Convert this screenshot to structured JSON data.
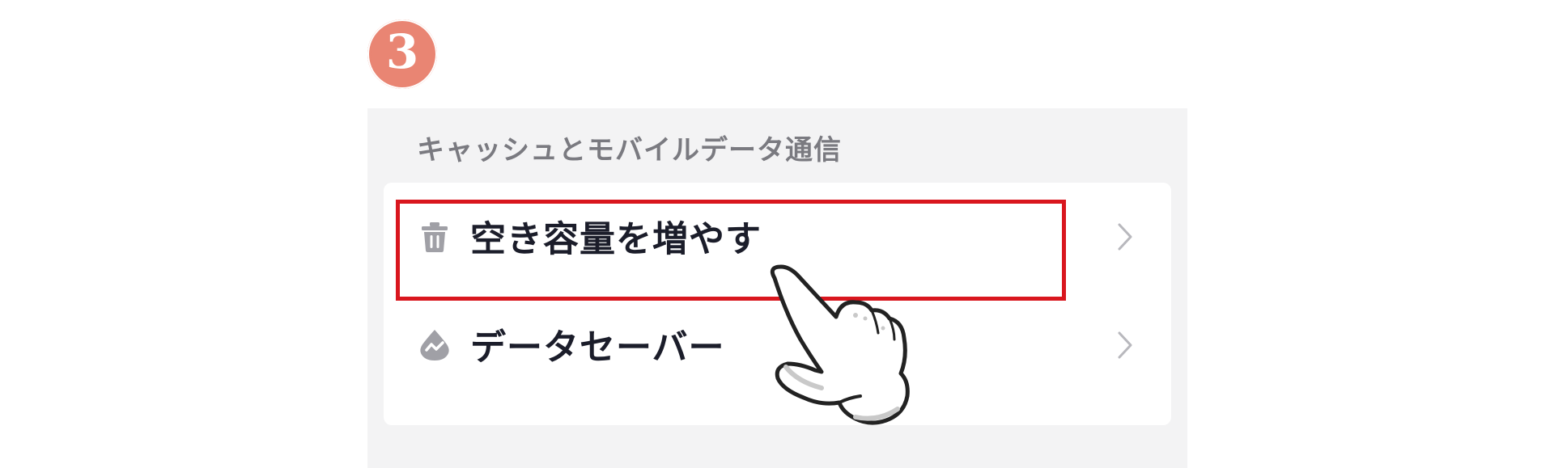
{
  "step": {
    "number": "3"
  },
  "section": {
    "title": "キャッシュとモバイルデータ通信"
  },
  "items": [
    {
      "label": "空き容量を増やす",
      "icon": "trash-icon",
      "highlighted": true
    },
    {
      "label": "データセーバー",
      "icon": "data-saver-icon",
      "highlighted": false
    }
  ],
  "colors": {
    "badge": "#e98573",
    "highlight": "#d9161e",
    "panel_bg": "#f3f3f4",
    "card_bg": "#ffffff",
    "section_title": "#7a7a80",
    "label": "#1b1d2a",
    "icon": "#a0a0a6",
    "chevron": "#b8b8bd"
  },
  "overlay": {
    "pointer": "hand-pointer-icon"
  }
}
